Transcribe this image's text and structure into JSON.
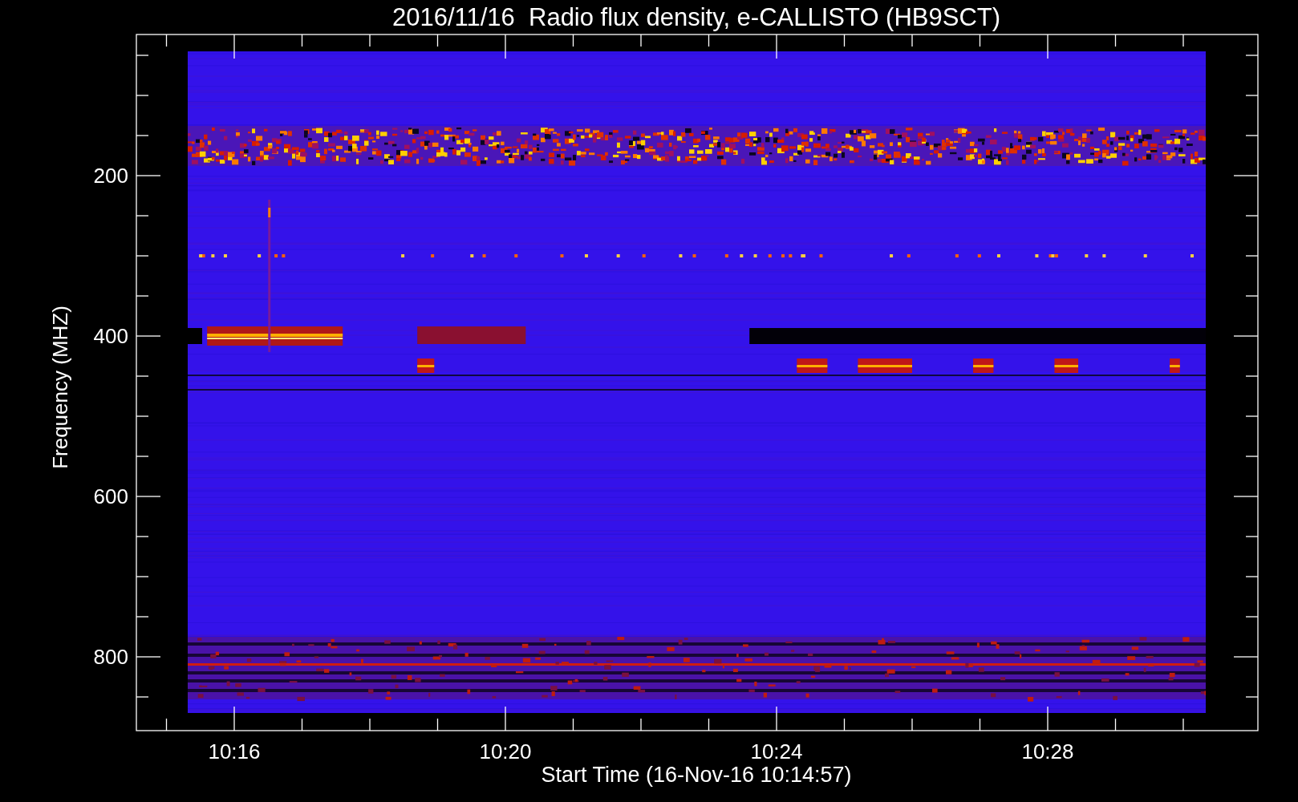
{
  "title": "2016/11/16  Radio flux density, e-CALLISTO (HB9SCT)",
  "y_axis": {
    "label": "Frequency (MHZ)",
    "tick_labels": [
      "200",
      "400",
      "600",
      "800"
    ]
  },
  "x_axis": {
    "label": "Start Time (16-Nov-16 10:14:57)",
    "tick_labels": [
      "10:16",
      "10:20",
      "10:24",
      "10:28"
    ]
  }
}
